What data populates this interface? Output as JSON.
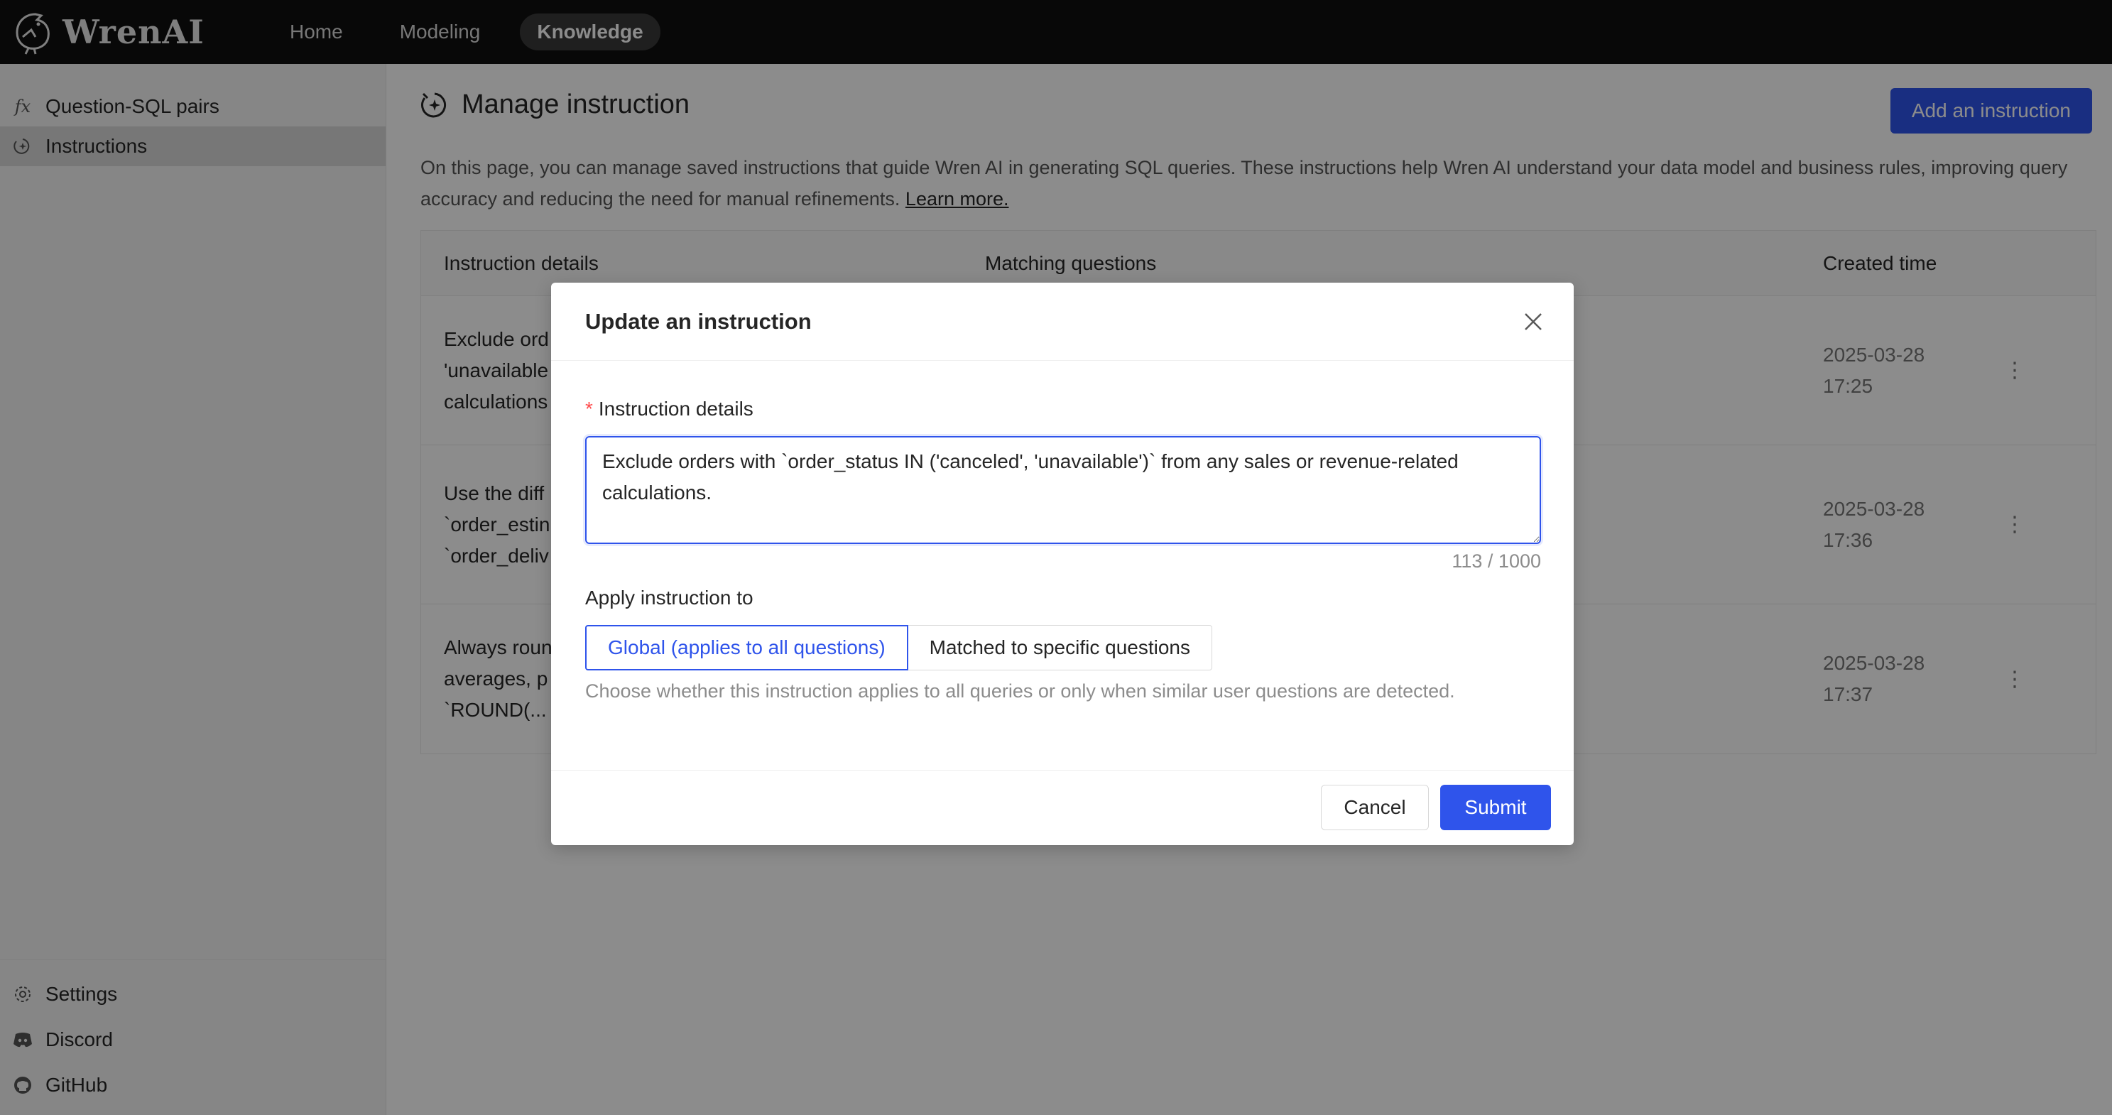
{
  "app": {
    "name": "WrenAI"
  },
  "nav": {
    "items": [
      {
        "label": "Home",
        "active": false
      },
      {
        "label": "Modeling",
        "active": false
      },
      {
        "label": "Knowledge",
        "active": true
      }
    ]
  },
  "sidebar": {
    "items": [
      {
        "label": "Question-SQL pairs",
        "icon": "function-icon",
        "active": false
      },
      {
        "label": "Instructions",
        "icon": "instruction-icon",
        "active": true
      }
    ],
    "bottom": [
      {
        "label": "Settings",
        "icon": "gear-icon"
      },
      {
        "label": "Discord",
        "icon": "discord-icon"
      },
      {
        "label": "GitHub",
        "icon": "github-icon"
      }
    ]
  },
  "page": {
    "title": "Manage instruction",
    "add_button": "Add an instruction",
    "description": "On this page, you can manage saved instructions that guide Wren AI in generating SQL queries. These instructions help Wren AI understand your data model and business rules, improving query accuracy and reducing the need for manual refinements.",
    "learn_more": "Learn more."
  },
  "table": {
    "columns": [
      "Instruction details",
      "Matching questions",
      "Created time"
    ],
    "rows": [
      {
        "details_lines": [
          "Exclude ord",
          "'unavailable",
          "calculations"
        ],
        "created_date": "2025-03-28",
        "created_time": "17:25",
        "menu": "⋮"
      },
      {
        "details_lines": [
          "Use the diff",
          "`order_estin",
          "`order_deliv"
        ],
        "created_date": "2025-03-28",
        "created_time": "17:36",
        "menu": "⋮"
      },
      {
        "details_lines": [
          "Always roun",
          "averages, p",
          "`ROUND(..."
        ],
        "created_date": "2025-03-28",
        "created_time": "17:37",
        "menu": "⋮"
      }
    ]
  },
  "modal": {
    "title": "Update an instruction",
    "field_label": "Instruction details",
    "required_mark": "*",
    "textarea_value": "Exclude orders with `order_status IN ('canceled', 'unavailable')` from any sales or revenue-related calculations.",
    "char_count": "113 / 1000",
    "apply_label": "Apply instruction to",
    "options": [
      {
        "label": "Global (applies to all questions)",
        "selected": true
      },
      {
        "label": "Matched to specific questions",
        "selected": false
      }
    ],
    "hint": "Choose whether this instruction applies to all queries or only when similar user questions are detected.",
    "cancel": "Cancel",
    "submit": "Submit"
  },
  "colors": {
    "primary": "#2f54eb",
    "topbar": "#0f0f0f",
    "required": "#ff4d4f"
  }
}
